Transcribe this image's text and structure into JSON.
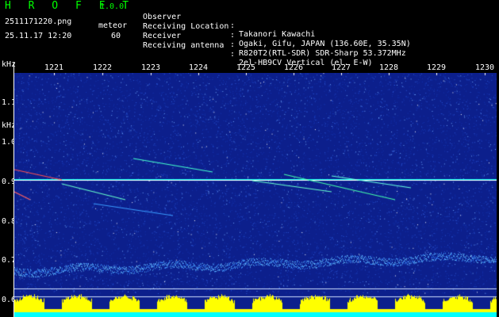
{
  "header": {
    "app_title": "H R O F F T",
    "app_version": "1.0.0",
    "file_name": "2511171220.png",
    "mode_label": "meteor",
    "datetime": "25.11.17 12:20",
    "count": "60",
    "info": [
      {
        "label": "Observer",
        "value": "Takanori Kawachi"
      },
      {
        "label": "Receiving Location",
        "value": "Ogaki, Gifu, JAPAN (136.60E, 35.35N)"
      },
      {
        "label": "Receiver",
        "value": "R820T2(RTL-SDR) SDR-Sharp 53.372MHz"
      },
      {
        "label": "Receiving antenna",
        "value": "2el-HB9CV Vertical (el. E-W)"
      }
    ]
  },
  "axes": {
    "unit": "kHz",
    "time_labels": [
      "1221",
      "1222",
      "1223",
      "1224",
      "1225",
      "1226",
      "1227",
      "1228",
      "1229",
      "1230"
    ],
    "freq_labels": [
      "1.1",
      "1.0",
      "0.9",
      "0.8",
      "0.7",
      "0.6"
    ]
  },
  "colors": {
    "background": "#000000",
    "spectrogram_bg": "#0c1f8c",
    "carrier": "#00ffee",
    "level_yellow": "#ffff00",
    "level_cyan": "#00ffff",
    "title_green": "#00ff00"
  }
}
